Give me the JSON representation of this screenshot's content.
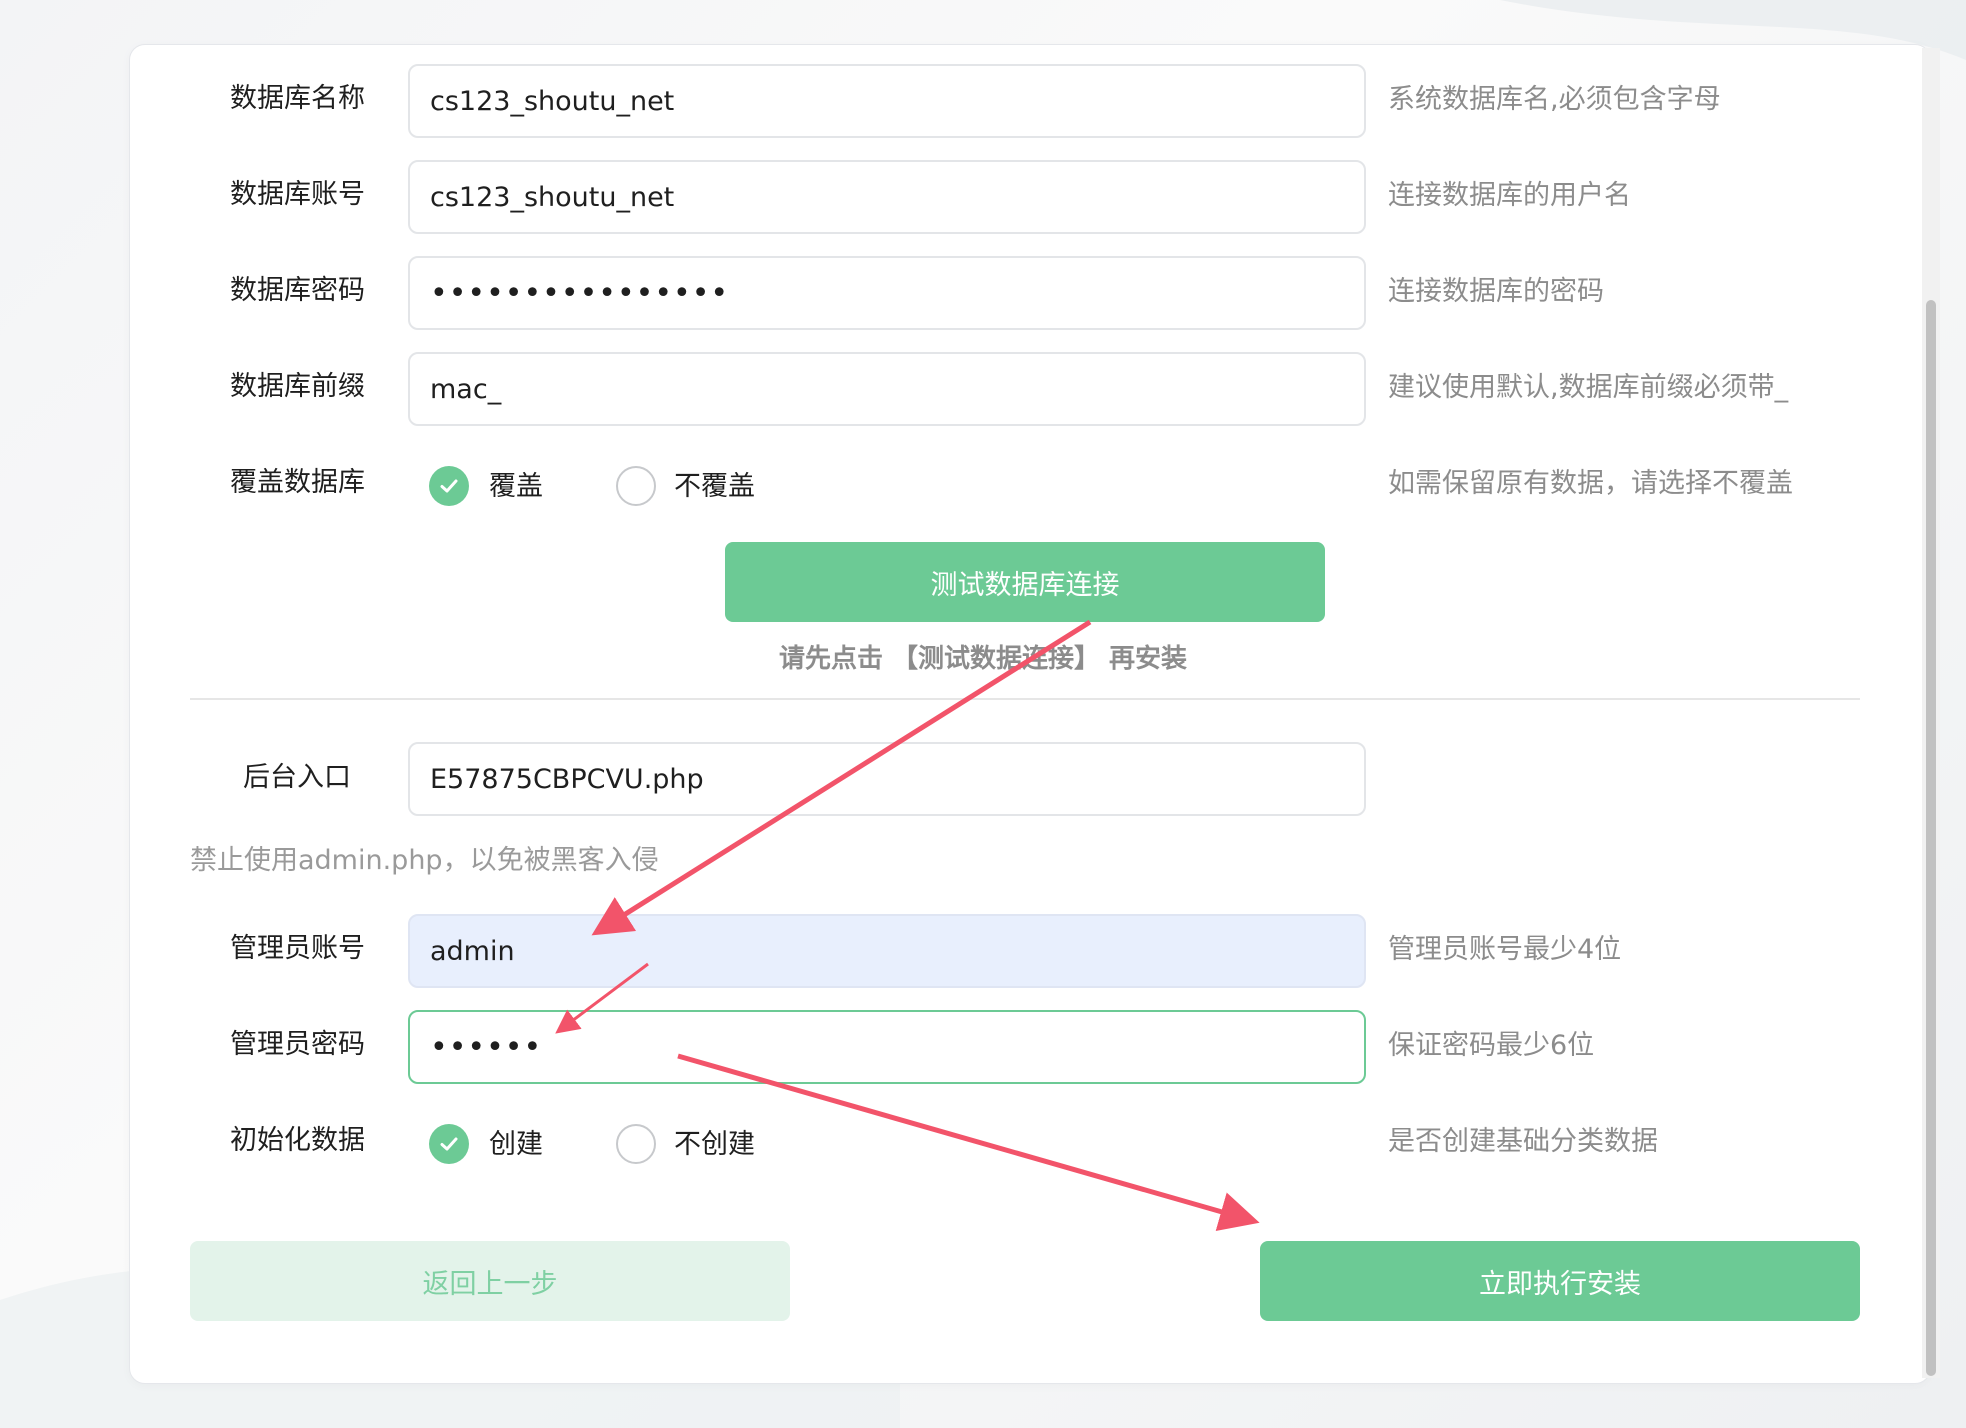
{
  "colors": {
    "accent": "#6cca95",
    "accent_light": "#e3f3ea",
    "hint_gray": "#8c8c8c",
    "arrow_red": "#f2546a",
    "autofill_blue": "#e8effd"
  },
  "db": {
    "name": {
      "label": "数据库名称",
      "value": "cs123_shoutu_net",
      "hint": "系统数据库名,必须包含字母"
    },
    "account": {
      "label": "数据库账号",
      "value": "cs123_shoutu_net",
      "hint": "连接数据库的用户名"
    },
    "password": {
      "label": "数据库密码",
      "value": "••••••••••••••••",
      "hint": "连接数据库的密码"
    },
    "prefix": {
      "label": "数据库前缀",
      "value": "mac_",
      "hint": "建议使用默认,数据库前缀必须带_"
    },
    "overwrite": {
      "label": "覆盖数据库",
      "options": [
        "覆盖",
        "不覆盖"
      ],
      "selected": "覆盖",
      "hint": "如需保留原有数据，请选择不覆盖"
    },
    "test_button": "测试数据库连接",
    "tip": "请先点击 【测试数据连接】 再安装"
  },
  "admin": {
    "entry": {
      "label": "后台入口",
      "value": "E57875CBPCVU.php"
    },
    "entry_warning": "禁止使用admin.php，以免被黑客入侵",
    "username": {
      "label": "管理员账号",
      "value": "admin",
      "hint": "管理员账号最少4位"
    },
    "password": {
      "label": "管理员密码",
      "value": "••••••",
      "hint": "保证密码最少6位"
    },
    "init_data": {
      "label": "初始化数据",
      "options": [
        "创建",
        "不创建"
      ],
      "selected": "创建",
      "hint": "是否创建基础分类数据"
    }
  },
  "buttons": {
    "back": "返回上一步",
    "install": "立即执行安装"
  }
}
